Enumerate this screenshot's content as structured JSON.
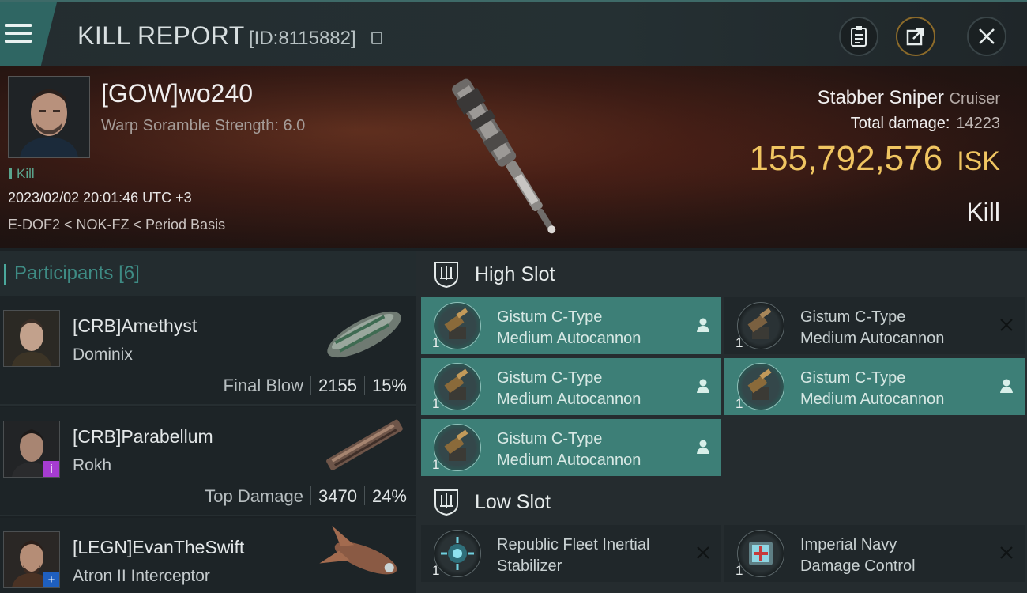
{
  "header": {
    "title": "KILL REPORT",
    "report_id": "[ID:8115882]",
    "icons": [
      "menu-icon",
      "copy-icon",
      "clipboard-icon",
      "share-icon",
      "close-icon"
    ]
  },
  "victim": {
    "name": "[GOW]wo240",
    "scramble": "Warp Soramble Strength: 6.0",
    "tag": "Kill",
    "timestamp": "2023/02/02 20:01:46 UTC +3",
    "location": "E-DOF2 < NOK-FZ < Period Basis",
    "ship_name": "Stabber Sniper",
    "ship_class": "Cruiser",
    "damage_label": "Total damage:",
    "damage_value": "14223",
    "isk_value": "155,792,576",
    "isk_unit": "ISK",
    "result": "Kill"
  },
  "participants": {
    "label": "Participants",
    "count": "[6]",
    "rows": [
      {
        "name": "[CRB]Amethyst",
        "ship": "Dominix",
        "role": "Final Blow",
        "damage": "2155",
        "percent": "15%"
      },
      {
        "name": "[CRB]Parabellum",
        "ship": "Rokh",
        "role": "Top Damage",
        "damage": "3470",
        "percent": "24%"
      },
      {
        "name": "[LEGN]EvanTheSwift",
        "ship": "Atron II Interceptor",
        "role": "",
        "damage": "",
        "percent": ""
      }
    ]
  },
  "slots": {
    "high": {
      "title": "High Slot",
      "modules": [
        {
          "qty": "1",
          "line1": "Gistum C-Type",
          "line2": "Medium Autocannon",
          "state": "dropped"
        },
        {
          "qty": "1",
          "line1": "Gistum C-Type",
          "line2": "Medium Autocannon",
          "state": "destroyed"
        },
        {
          "qty": "1",
          "line1": "Gistum C-Type",
          "line2": "Medium Autocannon",
          "state": "dropped"
        },
        {
          "qty": "1",
          "line1": "Gistum C-Type",
          "line2": "Medium Autocannon",
          "state": "dropped"
        },
        {
          "qty": "1",
          "line1": "Gistum C-Type",
          "line2": "Medium Autocannon",
          "state": "dropped"
        }
      ]
    },
    "low": {
      "title": "Low Slot",
      "modules": [
        {
          "qty": "1",
          "line1": "Republic Fleet Inertial",
          "line2": "Stabilizer",
          "state": "destroyed"
        },
        {
          "qty": "1",
          "line1": "Imperial Navy",
          "line2": "Damage Control",
          "state": "destroyed"
        }
      ]
    }
  },
  "colors": {
    "accent": "#3d7f77",
    "isk": "#f0c561",
    "kill": "#5aa58e"
  }
}
